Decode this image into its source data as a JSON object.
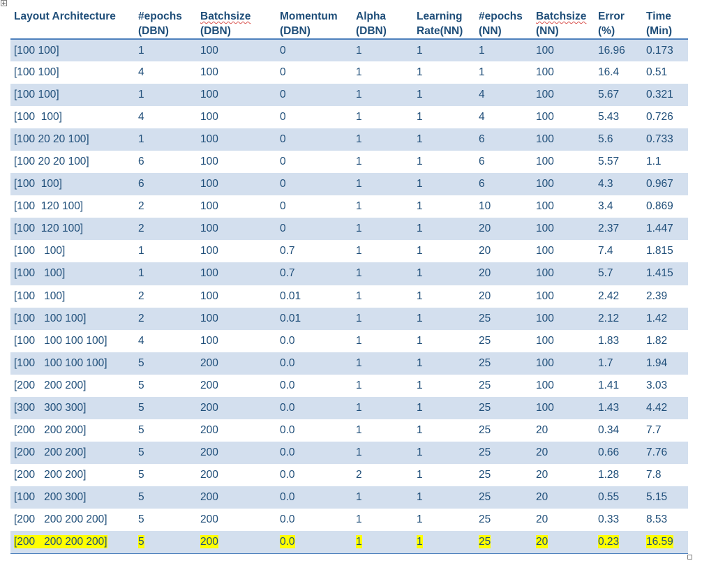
{
  "table": {
    "headers": [
      {
        "line1": "Layout Architecture",
        "line2": ""
      },
      {
        "line1": "#epochs",
        "line2": "(DBN)"
      },
      {
        "line1": "Batchsize",
        "line2": "(DBN)"
      },
      {
        "line1": "Momentum",
        "line2": "(DBN)"
      },
      {
        "line1": "Alpha",
        "line2": "(DBN)"
      },
      {
        "line1": "Learning",
        "line2": "Rate(NN)"
      },
      {
        "line1": "#epochs",
        "line2": "(NN)"
      },
      {
        "line1": "Batchsize",
        "line2": "(NN)"
      },
      {
        "line1": "Error",
        "line2": "(%)"
      },
      {
        "line1": "Time",
        "line2": "(Min)"
      }
    ],
    "rows": [
      [
        "[100 100]",
        "1",
        "100",
        "0",
        "1",
        "1",
        "1",
        "100",
        "16.96",
        "0.173"
      ],
      [
        "[100 100]",
        "4",
        "100",
        "0",
        "1",
        "1",
        "1",
        "100",
        "16.4",
        "0.51"
      ],
      [
        "[100 100]",
        "1",
        "100",
        "0",
        "1",
        "1",
        "4",
        "100",
        "5.67",
        "0.321"
      ],
      [
        "[100  100]",
        "4",
        "100",
        "0",
        "1",
        "1",
        "4",
        "100",
        "5.43",
        "0.726"
      ],
      [
        "[100 20 20 100]",
        "1",
        "100",
        "0",
        "1",
        "1",
        "6",
        "100",
        "5.6",
        "0.733"
      ],
      [
        "[100 20 20 100]",
        "6",
        "100",
        "0",
        "1",
        "1",
        "6",
        "100",
        "5.57",
        "1.1"
      ],
      [
        "[100  100]",
        "6",
        "100",
        "0",
        "1",
        "1",
        "6",
        "100",
        "4.3",
        "0.967"
      ],
      [
        "[100  120 100]",
        "2",
        "100",
        "0",
        "1",
        "1",
        "10",
        "100",
        "3.4",
        "0.869"
      ],
      [
        "[100  120 100]",
        "2",
        "100",
        "0",
        "1",
        "1",
        "20",
        "100",
        "2.37",
        "1.447"
      ],
      [
        "[100   100]",
        "1",
        "100",
        "0.7",
        "1",
        "1",
        "20",
        "100",
        "7.4",
        "1.815"
      ],
      [
        "[100   100]",
        "1",
        "100",
        "0.7",
        "1",
        "1",
        "20",
        "100",
        "5.7",
        "1.415"
      ],
      [
        "[100   100]",
        "2",
        "100",
        "0.01",
        "1",
        "1",
        "20",
        "100",
        "2.42",
        "2.39"
      ],
      [
        "[100   100 100]",
        "2",
        "100",
        "0.01",
        "1",
        "1",
        "25",
        "100",
        "2.12",
        "1.42"
      ],
      [
        "[100   100 100 100]",
        "4",
        "100",
        "0.0",
        "1",
        "1",
        "25",
        "100",
        "1.83",
        "1.82"
      ],
      [
        "[100   100 100 100]",
        "5",
        "200",
        "0.0",
        "1",
        "1",
        "25",
        "100",
        "1.7",
        "1.94"
      ],
      [
        "[200   200 200]",
        "5",
        "200",
        "0.0",
        "1",
        "1",
        "25",
        "100",
        "1.41",
        "3.03"
      ],
      [
        "[300   300 300]",
        "5",
        "200",
        "0.0",
        "1",
        "1",
        "25",
        "100",
        "1.43",
        "4.42"
      ],
      [
        "[200   200 200]",
        "5",
        "200",
        "0.0",
        "1",
        "1",
        "25",
        "20",
        "0.34",
        "7.7"
      ],
      [
        "[200   200 200]",
        "5",
        "200",
        "0.0",
        "1",
        "1",
        "25",
        "20",
        "0.66",
        "7.76"
      ],
      [
        "[200   200 200]",
        "5",
        "200",
        "0.0",
        "2",
        "1",
        "25",
        "20",
        "1.28",
        "7.8"
      ],
      [
        "[100   200 300]",
        "5",
        "200",
        "0.0",
        "1",
        "1",
        "25",
        "20",
        "0.55",
        "5.15"
      ],
      [
        "[200   200 200 200]",
        "5",
        "200",
        "0.0",
        "1",
        "1",
        "25",
        "20",
        "0.33",
        "8.53"
      ],
      [
        "[200   200 200 200]",
        "5",
        "200",
        "0.0",
        "1",
        "1",
        "25",
        "20",
        "0.23",
        "16.59"
      ]
    ],
    "highlighted_row": 22,
    "colors": {
      "text": "#1f4e79",
      "band": "#d3dfee",
      "rule": "#4f81bd",
      "highlight": "#ffff00",
      "spellcheck": "#d9534f"
    }
  },
  "icons": {
    "table_move_handle": "move-arrows-icon",
    "table_resize_handle": "resize-handle-icon"
  }
}
